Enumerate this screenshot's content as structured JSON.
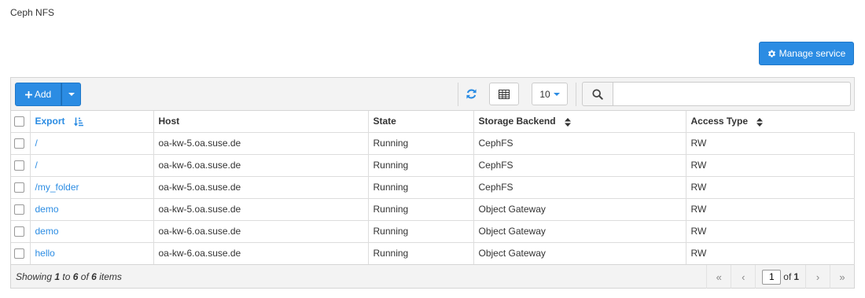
{
  "page": {
    "title": "Ceph NFS"
  },
  "actions": {
    "manage_service": "Manage service"
  },
  "toolbar": {
    "add_label": "Add",
    "per_page": "10",
    "search_placeholder": "",
    "search_value": ""
  },
  "table": {
    "columns": [
      "Export",
      "Host",
      "State",
      "Storage Backend",
      "Access Type"
    ],
    "rows": [
      {
        "export": "/",
        "host": "oa-kw-5.oa.suse.de",
        "state": "Running",
        "backend": "CephFS",
        "access": "RW"
      },
      {
        "export": "/",
        "host": "oa-kw-6.oa.suse.de",
        "state": "Running",
        "backend": "CephFS",
        "access": "RW"
      },
      {
        "export": "/my_folder",
        "host": "oa-kw-5.oa.suse.de",
        "state": "Running",
        "backend": "CephFS",
        "access": "RW"
      },
      {
        "export": "demo",
        "host": "oa-kw-5.oa.suse.de",
        "state": "Running",
        "backend": "Object Gateway",
        "access": "RW"
      },
      {
        "export": "demo",
        "host": "oa-kw-6.oa.suse.de",
        "state": "Running",
        "backend": "Object Gateway",
        "access": "RW"
      },
      {
        "export": "hello",
        "host": "oa-kw-6.oa.suse.de",
        "state": "Running",
        "backend": "Object Gateway",
        "access": "RW"
      }
    ]
  },
  "footer": {
    "showing_prefix": "Showing",
    "from": "1",
    "to_word": "to",
    "to": "6",
    "of_word": "of",
    "total": "6",
    "items_word": "items",
    "current_page": "1",
    "page_of": "of",
    "total_pages": "1"
  },
  "icons": {
    "manage": "gear-icon",
    "add": "plus-icon",
    "refresh": "refresh-icon",
    "columns": "table-columns-icon",
    "search": "search-icon",
    "sort_active": "sort-amount-asc-icon",
    "sort": "sort-icon",
    "first": "double-chevron-left-icon",
    "prev": "chevron-left-icon",
    "next": "chevron-right-icon",
    "last": "double-chevron-right-icon"
  },
  "colors": {
    "accent": "#2b8ce3",
    "toolbar_bg": "#f3f3f3"
  }
}
